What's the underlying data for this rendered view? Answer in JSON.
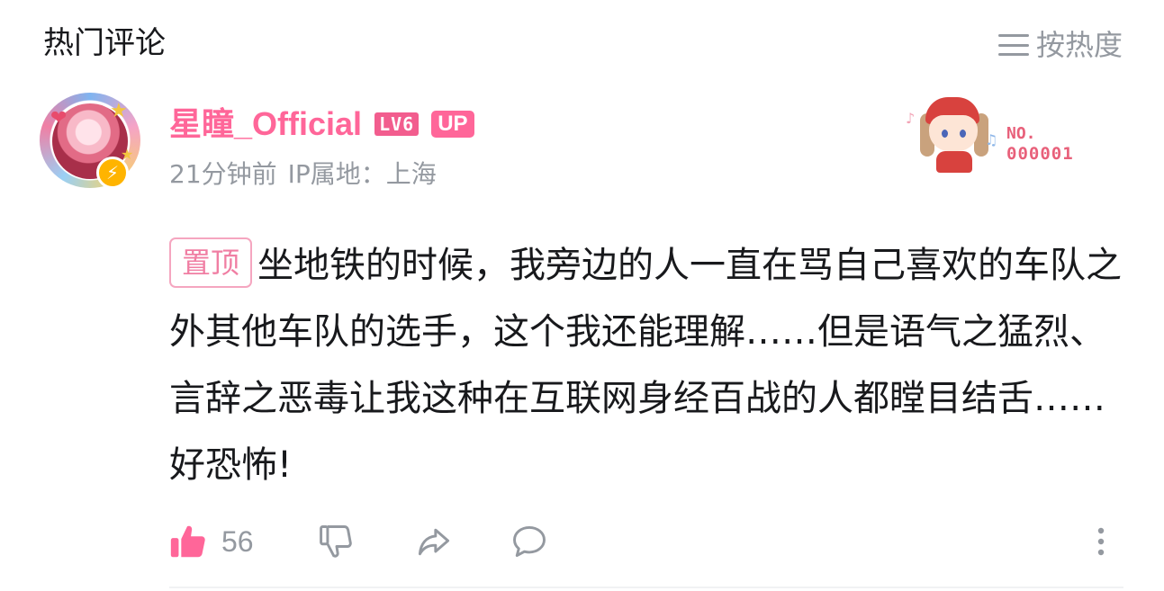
{
  "header": {
    "title": "热门评论",
    "sort_label": "按热度"
  },
  "comment": {
    "username": "星瞳_Official",
    "level_badge": "LV6",
    "up_badge": "UP",
    "time": "21分钟前",
    "ip_location": "IP属地：上海",
    "pin_label": "置顶",
    "text": "坐地铁的时候，我旁边的人一直在骂自己喜欢的车队之外其他车队的选手，这个我还能理解……但是语气之猛烈、言辞之恶毒让我这种在互联网身经百战的人都瞠目结舌……好恐怖!",
    "fan_badge_no": "NO.",
    "fan_badge_number": "000001",
    "like_count": "56"
  },
  "icons": {
    "sort": "menu-lines-icon",
    "verify": "lightning-icon",
    "like": "thumbs-up-filled-icon",
    "dislike": "thumbs-down-outline-icon",
    "share": "share-arrow-icon",
    "reply": "speech-bubble-icon",
    "more": "vertical-dots-icon"
  },
  "colors": {
    "brand_pink": "#ff6699",
    "muted": "#9499a0",
    "verify_yellow": "#ffb400"
  }
}
